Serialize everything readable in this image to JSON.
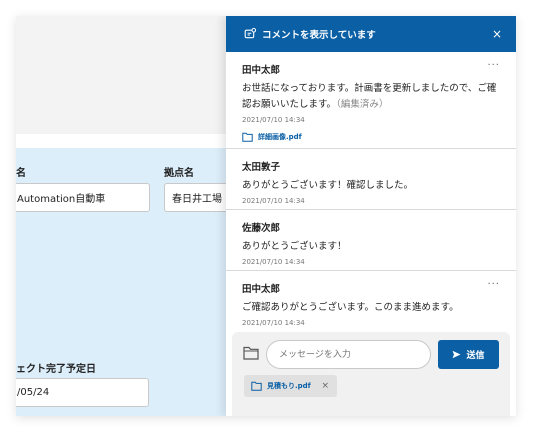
{
  "form": {
    "name_label": "名",
    "name_value": "Automation自動車",
    "base_label": "拠点名",
    "base_value": "春日井工場",
    "completion_label": "ェクト完了予定日",
    "completion_value": "/05/24"
  },
  "panel": {
    "title": "コメントを表示しています",
    "close_label": "×",
    "more_label": "···",
    "comments": [
      {
        "author": "田中太郎",
        "body": "お世話になっております。計画書を更新しましたので、ご確認お願いいたします。",
        "edited": "（編集済み）",
        "time": "2021/07/10 14:34",
        "attachment": "詳細画像.pdf"
      },
      {
        "author": "太田敦子",
        "body": "ありがとうございます！確認しました。",
        "time": "2021/07/10 14:34"
      },
      {
        "author": "佐藤次郎",
        "body": "ありがとうございます！",
        "time": "2021/07/10 14:34"
      },
      {
        "author": "田中太郎",
        "body": "ご確認ありがとうございます。このまま進めます。",
        "time": "2021/07/10 14:34"
      }
    ]
  },
  "composer": {
    "placeholder": "メッセージを入力",
    "send_label": "送信",
    "attachment": "見積もり.pdf",
    "remove_label": "×"
  },
  "colors": {
    "primary": "#0a5fa5",
    "form_bg": "#dceefa"
  }
}
